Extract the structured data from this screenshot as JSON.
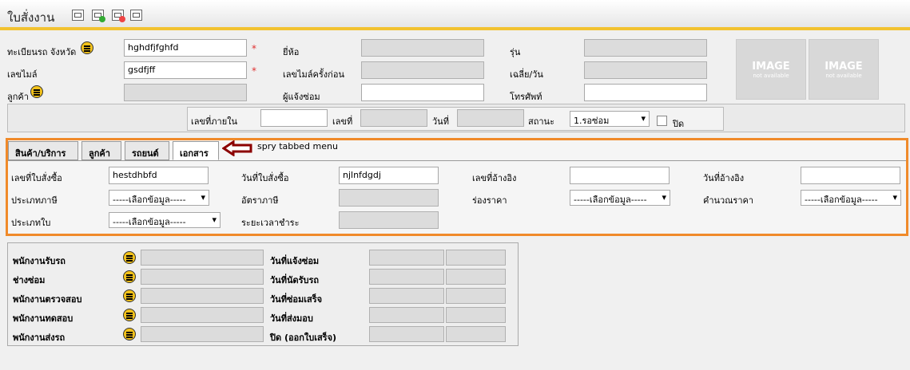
{
  "header": {
    "title": "ใบสั่งงาน",
    "icons": [
      "view-icon",
      "add-icon",
      "delete-icon",
      "print-icon"
    ]
  },
  "form": {
    "plate_label": "ทะเบียนรถ จังหวัด",
    "plate_value": "hghdfjfghfd",
    "brand_label": "ยี่ห้อ",
    "model_label": "รุ่น",
    "mileage_label": "เลขไมล์",
    "mileage_value": "gsdfjff",
    "prev_mileage_label": "เลขไมล์ครั้งก่อน",
    "avg_label": "เฉลี่ย/วัน",
    "customer_label": "ลูกค้า",
    "reporter_label": "ผู้แจ้งซ่อม",
    "phone_label": "โทรศัพท์",
    "required": "*",
    "image_text": "IMAGE",
    "image_sub": "not available"
  },
  "status_bar": {
    "internal_label": "เลขที่ภายใน",
    "number_label": "เลขที่",
    "date_label": "วันที่",
    "status_label": "สถานะ",
    "status_value": "1.รอซ่อม",
    "close_label": "ปิด"
  },
  "tabs": [
    {
      "label": "สินค้า/บริการ"
    },
    {
      "label": "ลูกค้า"
    },
    {
      "label": "รถยนต์"
    },
    {
      "label": "เอกสาร"
    }
  ],
  "annotation": "spry tabbed menu",
  "document": {
    "po_no_label": "เลขที่ใบสั่งซื้อ",
    "po_no_value": "hestdhbfd",
    "po_date_label": "วันที่ใบสั่งซื้อ",
    "po_date_value": "njlnfdgdj",
    "ref_no_label": "เลขที่อ้างอิง",
    "ref_date_label": "วันที่อ้างอิง",
    "tax_type_label": "ประเภทภาษี",
    "tax_rate_label": "อัตราภาษี",
    "price_range_label": "ร่องราคา",
    "price_calc_label": "คำนวณราคา",
    "doc_type_label": "ประเภทใบ",
    "payment_label": "ระยะเวลาชำระ",
    "select_placeholder": "-----เลือกข้อมูล-----"
  },
  "staff": {
    "rows": [
      {
        "left": "พนักงานรับรถ",
        "right": "วันที่แจ้งซ่อม"
      },
      {
        "left": "ช่างซ่อม",
        "right": "วันที่นัดรับรถ"
      },
      {
        "left": "พนักงานตรวจสอบ",
        "right": "วันที่ซ่อมเสร็จ"
      },
      {
        "left": "พนักงานทดสอบ",
        "right": "วันที่ส่งมอบ"
      },
      {
        "left": "พนักงานส่งรถ",
        "right": "ปิด (ออกใบเสร็จ)"
      }
    ]
  },
  "colors": {
    "accent": "#f2c230",
    "highlight": "#f08a2a",
    "arrow": "#8b0000"
  }
}
